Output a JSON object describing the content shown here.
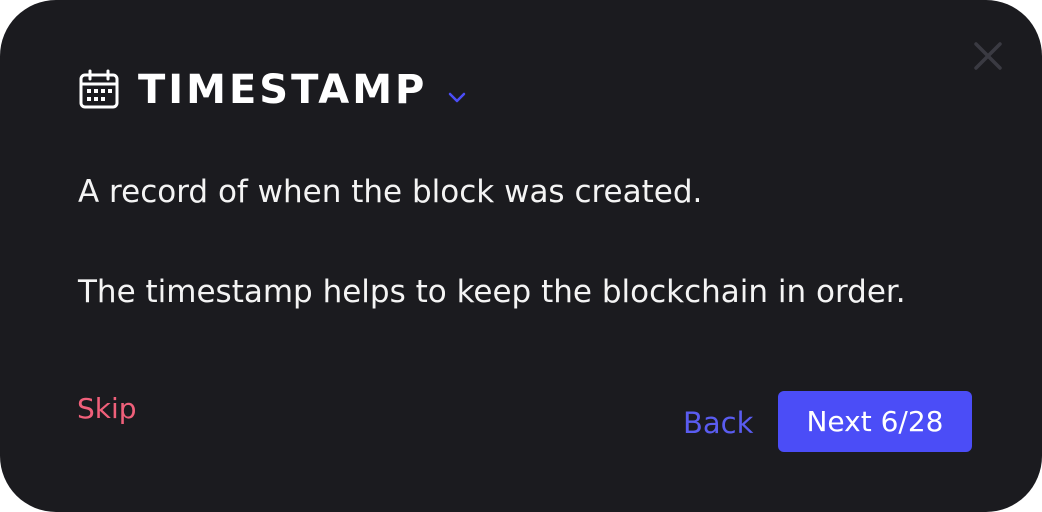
{
  "popup": {
    "title": "TIMESTAMP",
    "title_icon": "calendar-icon",
    "dropdown_icon": "chevron-down-icon",
    "close_icon": "close-icon",
    "description_lines": [
      "A record of when the block was created.",
      "The timestamp helps to keep the blockchain in order."
    ],
    "skip_label": "Skip",
    "back_label": "Back",
    "next_label": "Next 6/28"
  },
  "colors": {
    "background": "#1b1b1f",
    "accent": "#4b4df7",
    "back_text": "#5a5cf0",
    "skip_text": "#f0607a",
    "close_icon": "#3a3a42"
  }
}
